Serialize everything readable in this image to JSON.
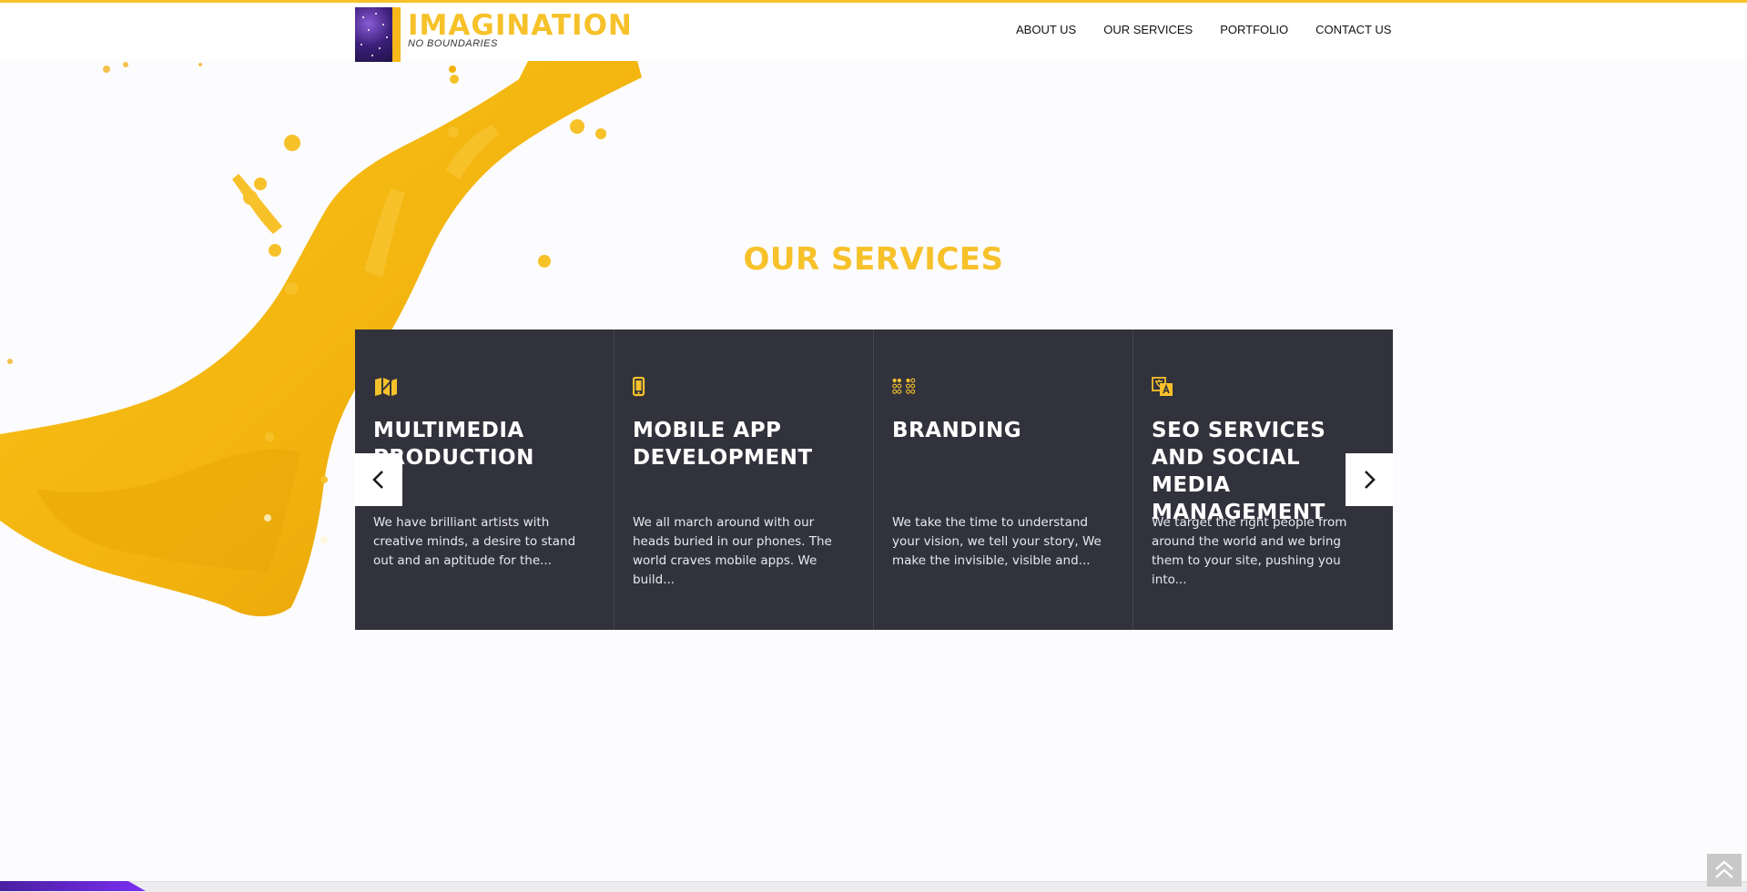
{
  "brand": {
    "title": "IMAGINATION",
    "tagline": "NO BOUNDARIES",
    "accent_color": "#f7c12a",
    "logo_icon": "galaxy-logo-icon"
  },
  "nav": {
    "items": [
      {
        "label": "ABOUT US"
      },
      {
        "label": "OUR SERVICES"
      },
      {
        "label": "PORTFOLIO"
      },
      {
        "label": "CONTACT US"
      }
    ]
  },
  "services": {
    "heading": "OUR SERVICES",
    "card_background": "#32323d",
    "cards": [
      {
        "icon": "map-icon",
        "title": "MULTIMEDIA PRODUCTION",
        "text": "We have brilliant artists with creative minds, a desire to stand out and an aptitude for the..."
      },
      {
        "icon": "mobile-phone-icon",
        "title": "MOBILE APP DEVELOPMENT",
        "text": "We all march around with our heads buried in our phones. The world craves mobile apps. We build..."
      },
      {
        "icon": "braille-dots-icon",
        "title": "BRANDING",
        "text": "We take the time to understand your vision, we tell your story, We make the invisible, visible and..."
      },
      {
        "icon": "translate-icon",
        "title": "SEO SERVICES AND SOCIAL MEDIA MANAGEMENT",
        "text": "We target the right people from around the world and we bring them to your site, pushing you into..."
      }
    ],
    "prev_icon": "chevron-left-icon",
    "next_icon": "chevron-right-icon"
  },
  "scroll_top_icon": "double-chevron-up-icon"
}
